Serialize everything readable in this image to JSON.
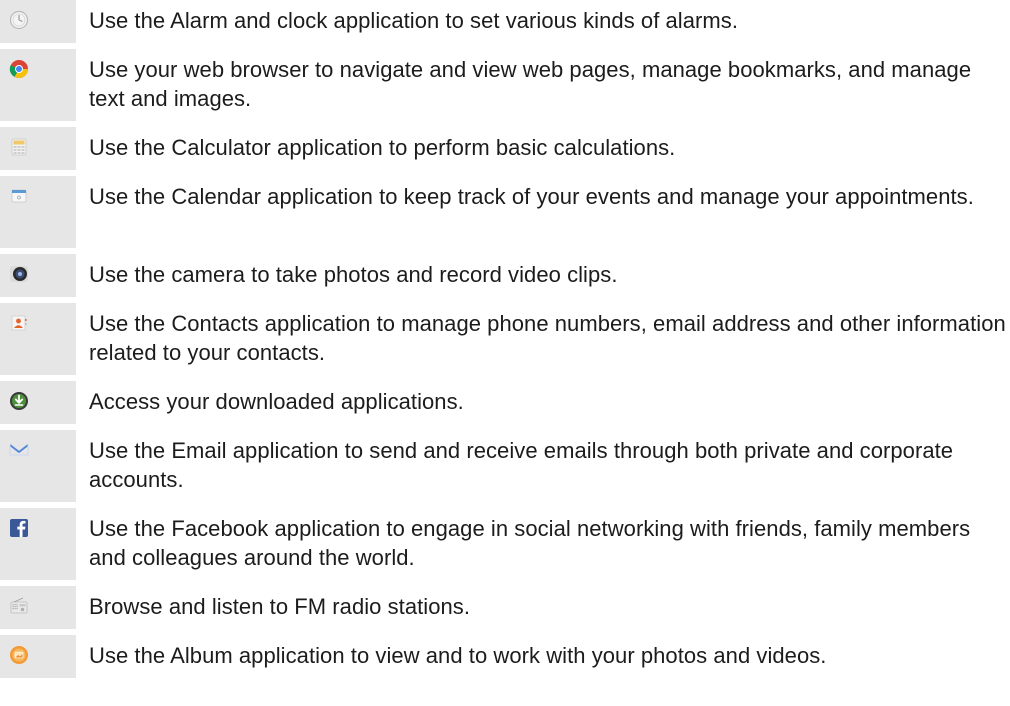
{
  "apps": [
    {
      "icon": "alarm-clock-icon",
      "description": "Use the Alarm and clock application to set various kinds of alarms."
    },
    {
      "icon": "browser-icon",
      "description": "Use your web browser to navigate and view web pages, manage bookmarks, and manage text and images."
    },
    {
      "icon": "calculator-icon",
      "description": "Use the Calculator application to perform basic calculations."
    },
    {
      "icon": "calendar-icon",
      "description": "Use the Calendar application to keep track of your events and manage your appointments."
    },
    {
      "icon": "camera-icon",
      "description": "Use the camera to take photos and record video clips."
    },
    {
      "icon": "contacts-icon",
      "description": "Use the Contacts application to manage phone numbers, email address and other information related to your contacts."
    },
    {
      "icon": "downloads-icon",
      "description": "Access your downloaded applications."
    },
    {
      "icon": "email-icon",
      "description": "Use the Email application to send and receive emails through both private and corporate accounts."
    },
    {
      "icon": "facebook-icon",
      "description": "Use the Facebook application to engage in social networking with friends, family members and colleagues around the world."
    },
    {
      "icon": "fm-radio-icon",
      "description": "Browse and listen to FM radio stations."
    },
    {
      "icon": "album-icon",
      "description": "Use the Album application to view and to work with your photos and videos."
    }
  ]
}
